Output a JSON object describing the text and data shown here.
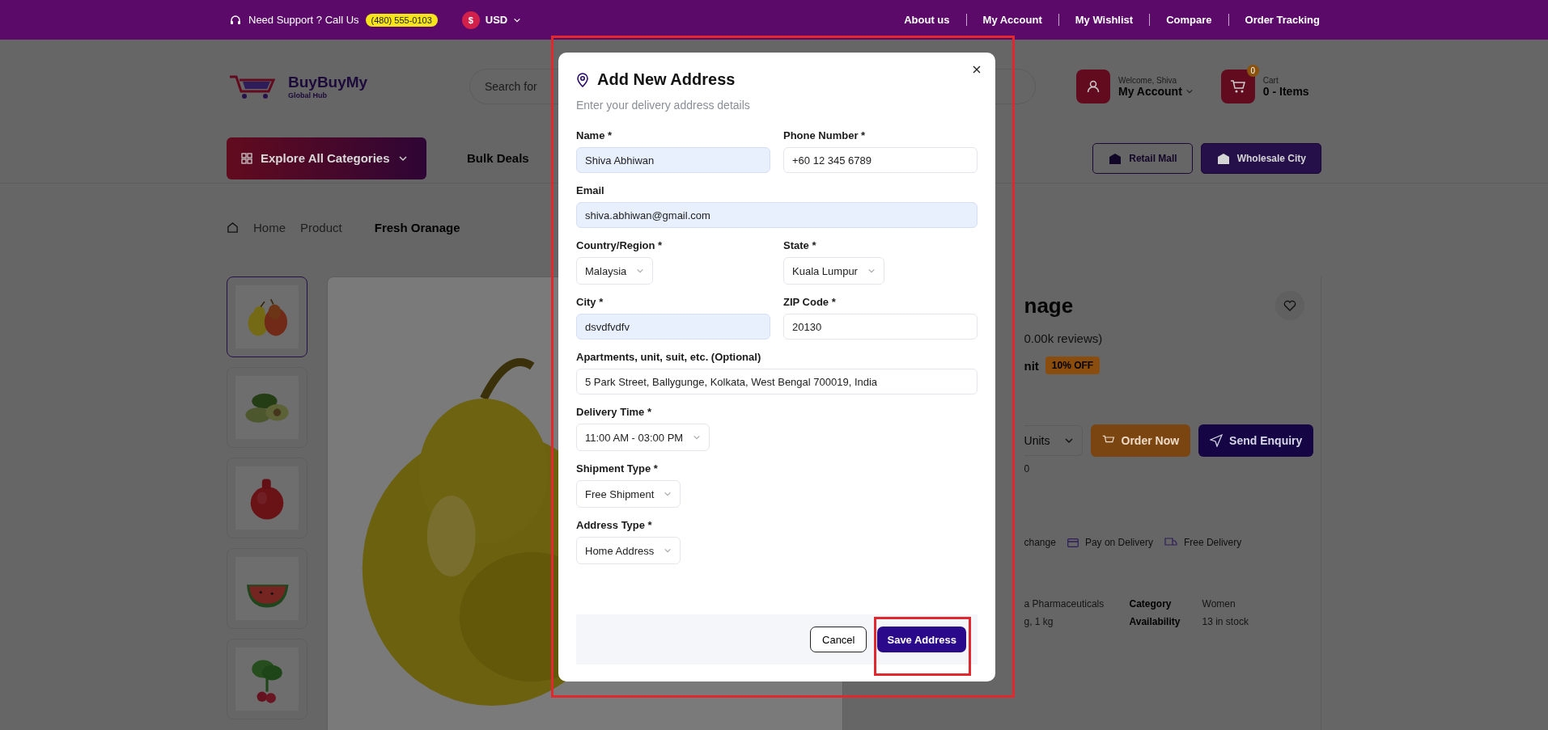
{
  "top_bar": {
    "support_label": "Need Support ? Call Us",
    "phone": "(480) 555-0103",
    "currency_symbol": "$",
    "currency": "USD",
    "links": [
      "About us",
      "My Account",
      "My Wishlist",
      "Compare",
      "Order Tracking"
    ]
  },
  "header": {
    "logo_name": "BuyBuyMy",
    "logo_tagline": "Global Hub",
    "search_placeholder": "Search for",
    "greeting": "Welcome, Shiva",
    "account": "My Account",
    "cart_count": "0",
    "cart_label": "Cart",
    "cart_items": "0 - Items"
  },
  "nav": {
    "categories_button": "Explore All Categories",
    "links": [
      "Bulk Deals"
    ],
    "buttons": [
      "Retail Mall",
      "Wholesale City"
    ]
  },
  "breadcrumb": [
    {
      "label": "Home",
      "selected": false
    },
    {
      "label": "Product",
      "selected": false
    },
    {
      "label": "Fresh Oranage",
      "selected": true
    }
  ],
  "thumbnails": [
    {
      "kind": "picture",
      "selected": true
    },
    {
      "kind": "picture",
      "selected": false
    },
    {
      "kind": "picture",
      "selected": false
    },
    {
      "kind": "picture",
      "selected": false
    },
    {
      "kind": "picture",
      "selected": false
    }
  ],
  "product": {
    "title": "nage",
    "reviews": "0.00k reviews)",
    "unit": "nit",
    "discount": "10% OFF",
    "quantity_unit": "Units",
    "order_button": "Order Now",
    "enquiry_button": "Send Enquiry",
    "price_fragment": "0",
    "features": [
      "change",
      "Pay on Delivery",
      "Free Delivery"
    ],
    "specs": [
      [
        "a Pharmaceuticals",
        "Category",
        "Women"
      ],
      [
        "g, 1 kg",
        "Availability",
        "13 in stock"
      ]
    ]
  },
  "modal": {
    "title": "Add New Address",
    "subtitle": "Enter your delivery address details",
    "rows": [
      [
        {
          "label": "Name *",
          "kind": "text",
          "value": "Shiva Abhiwan",
          "autofilled": true
        },
        {
          "label": "Phone Number *",
          "kind": "text",
          "value": "+60 12 345 6789",
          "autofilled": false
        }
      ],
      [
        {
          "label": "Email",
          "kind": "text",
          "value": "shiva.abhiwan@gmail.com",
          "autofilled": true
        }
      ],
      [
        {
          "label": "Country/Region *",
          "kind": "select",
          "value": "Malaysia"
        },
        {
          "label": "State *",
          "kind": "select",
          "value": "Kuala Lumpur"
        }
      ],
      [
        {
          "label": "City *",
          "kind": "text",
          "value": "dsvdfvdfv",
          "autofilled": true
        },
        {
          "label": "ZIP Code *",
          "kind": "text",
          "value": "20130",
          "autofilled": false
        }
      ],
      [
        {
          "label": "Apartments, unit, suit, etc. (Optional)",
          "kind": "text",
          "value": "5 Park Street, Ballygunge, Kolkata, West Bengal 700019, India",
          "autofilled": false
        }
      ],
      [
        {
          "label": "Delivery Time *",
          "kind": "select",
          "value": "11:00 AM - 03:00 PM"
        }
      ],
      [
        {
          "label": "Shipment Type *",
          "kind": "select",
          "value": "Free Shipment"
        }
      ],
      [
        {
          "label": "Address Type *",
          "kind": "select",
          "value": "Home Address"
        }
      ]
    ],
    "cancel_button": "Cancel",
    "save_button": "Save Address"
  }
}
